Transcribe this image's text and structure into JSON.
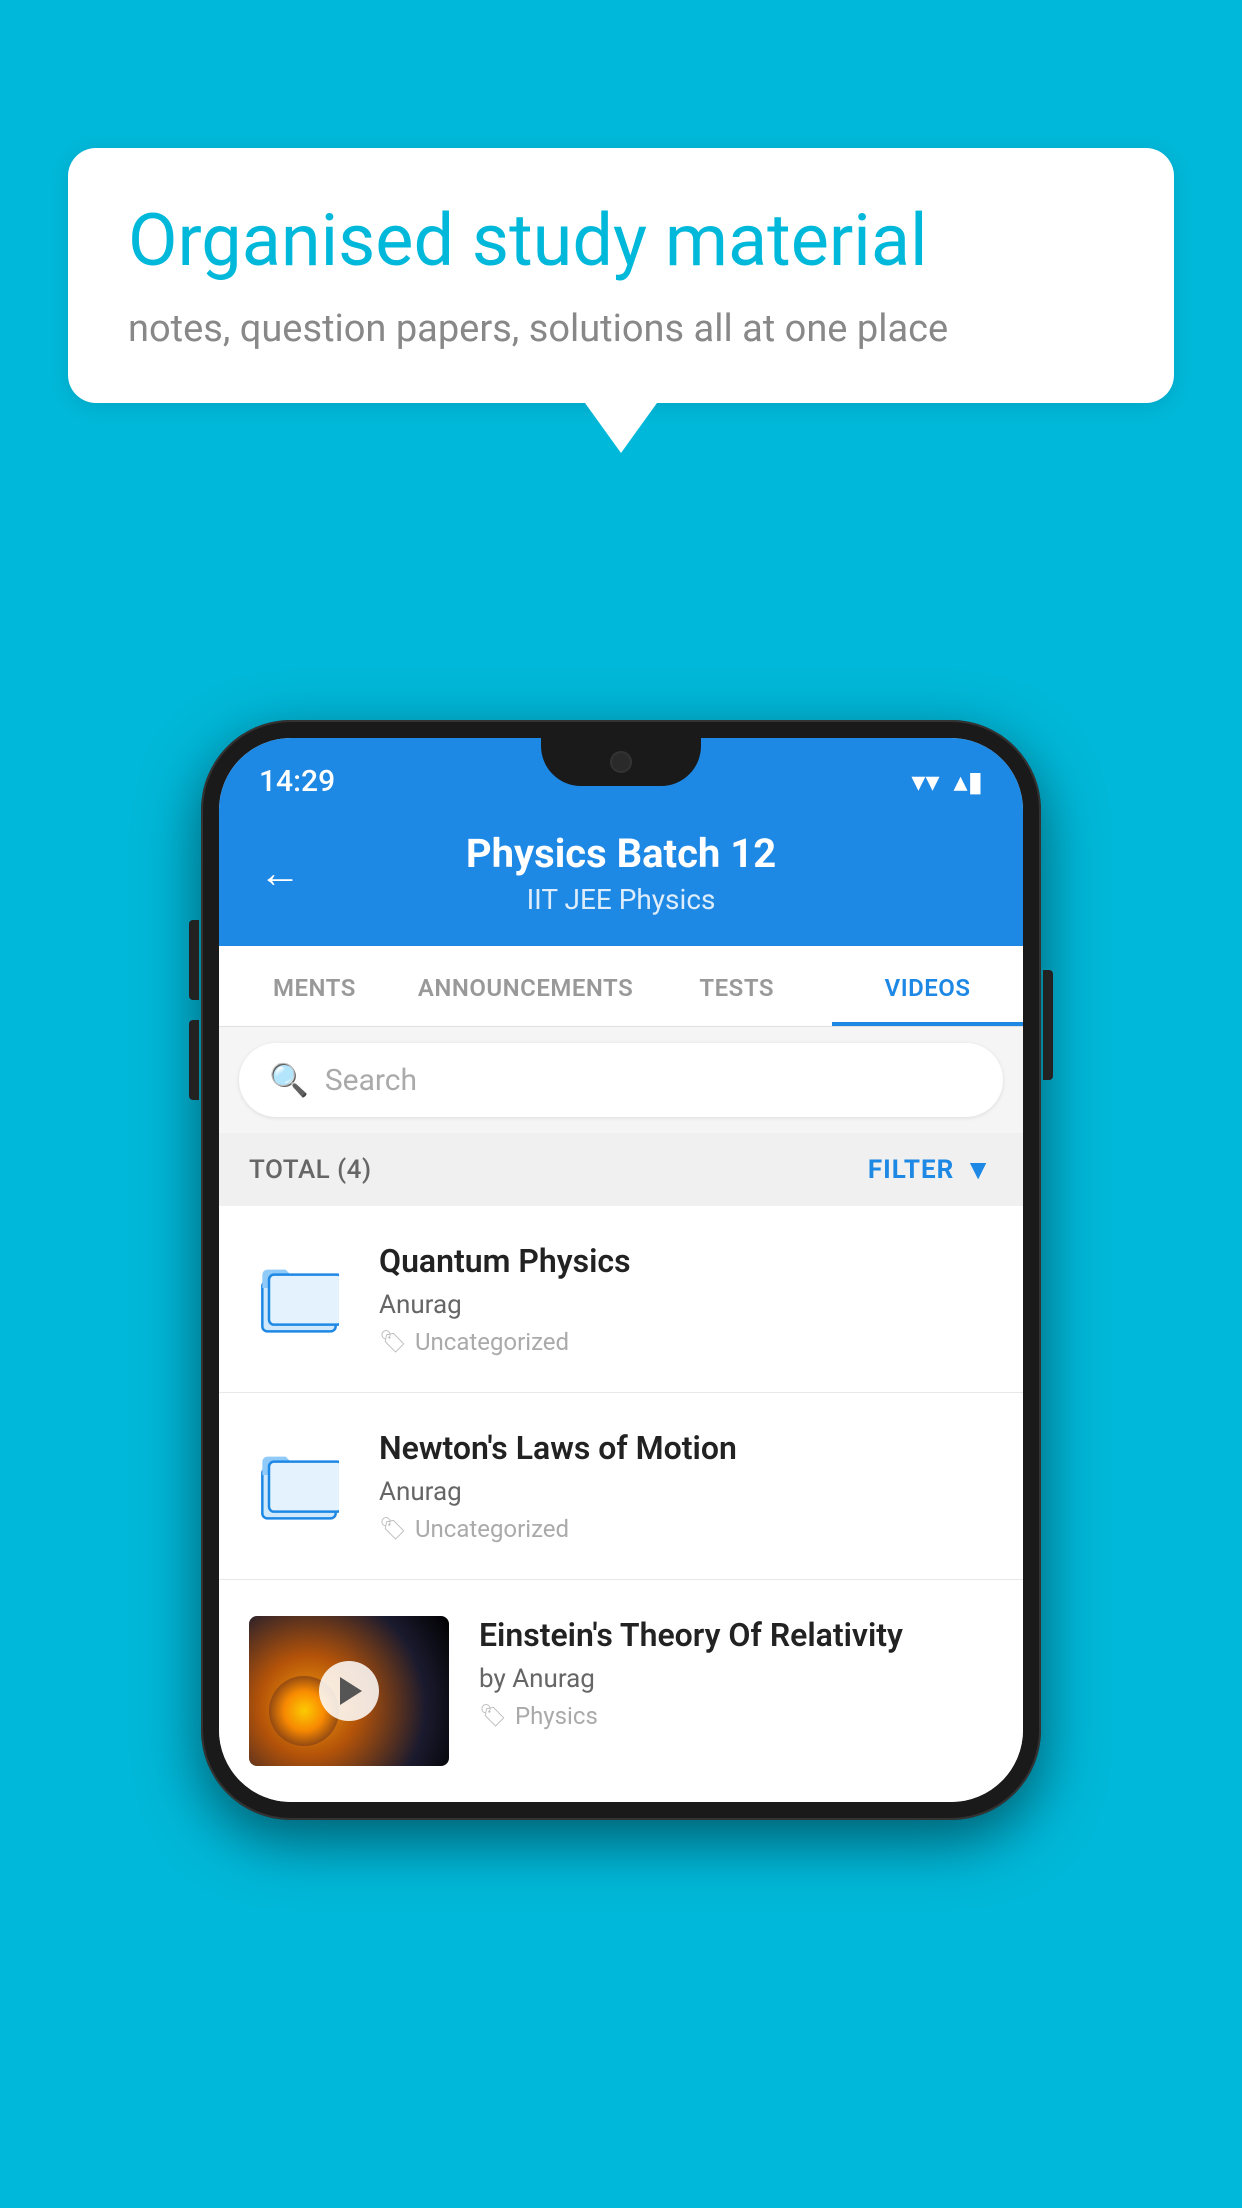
{
  "background_color": "#00B8D9",
  "speech_bubble": {
    "title": "Organised study material",
    "subtitle": "notes, question papers, solutions all at one place"
  },
  "status_bar": {
    "time": "14:29",
    "wifi_icon": "▾",
    "signal_icon": "▴",
    "battery_icon": "▮"
  },
  "header": {
    "back_label": "←",
    "title": "Physics Batch 12",
    "subtitle_tags": "IIT JEE   Physics"
  },
  "tabs": [
    {
      "label": "MENTS",
      "active": false
    },
    {
      "label": "ANNOUNCEMENTS",
      "active": false
    },
    {
      "label": "TESTS",
      "active": false
    },
    {
      "label": "VIDEOS",
      "active": true
    }
  ],
  "search": {
    "placeholder": "Search"
  },
  "filter_bar": {
    "total_label": "TOTAL (4)",
    "filter_label": "FILTER"
  },
  "videos": [
    {
      "id": 1,
      "title": "Quantum Physics",
      "author": "Anurag",
      "tag": "Uncategorized",
      "has_thumbnail": false
    },
    {
      "id": 2,
      "title": "Newton's Laws of Motion",
      "author": "Anurag",
      "tag": "Uncategorized",
      "has_thumbnail": false
    },
    {
      "id": 3,
      "title": "Einstein's Theory Of Relativity",
      "author": "by Anurag",
      "tag": "Physics",
      "has_thumbnail": true
    }
  ]
}
